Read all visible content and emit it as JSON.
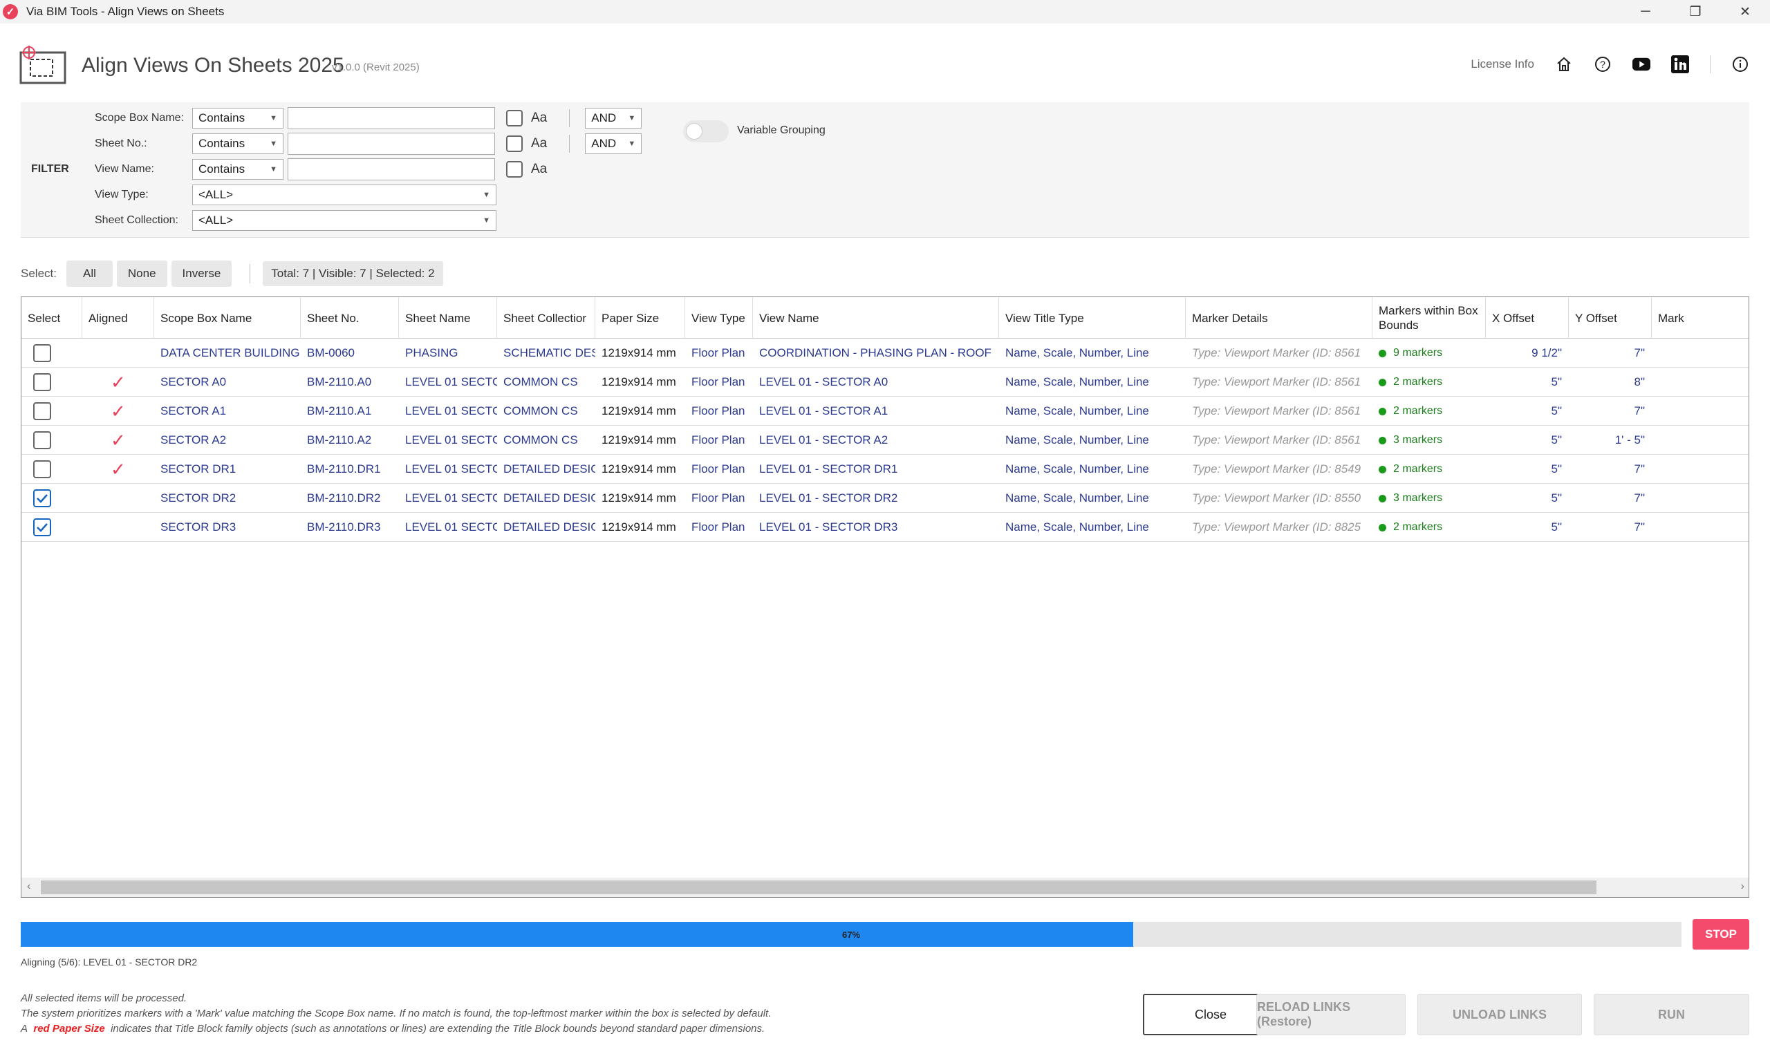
{
  "window": {
    "title": "Via BIM Tools - Align Views on Sheets"
  },
  "header": {
    "title": "Align Views On Sheets 2025",
    "version": "v1.0.0 (Revit 2025)",
    "license_label": "License Info"
  },
  "filter": {
    "label": "FILTER",
    "scope_box": {
      "label": "Scope Box Name:",
      "mode": "Contains",
      "value": "",
      "case_label": "Aa",
      "logic": "AND"
    },
    "sheet_no": {
      "label": "Sheet No.:",
      "mode": "Contains",
      "value": "",
      "case_label": "Aa",
      "logic": "AND"
    },
    "view_name": {
      "label": "View Name:",
      "mode": "Contains",
      "value": "",
      "case_label": "Aa"
    },
    "view_type": {
      "label": "View Type:",
      "value": "<ALL>"
    },
    "sheet_collection": {
      "label": "Sheet Collection:",
      "value": "<ALL>"
    },
    "variable_grouping": {
      "label": "Variable Grouping",
      "on": false
    }
  },
  "select_bar": {
    "label": "Select:",
    "all": "All",
    "none": "None",
    "inverse": "Inverse",
    "counts": "Total: 7 | Visible: 7 | Selected: 2"
  },
  "table": {
    "headers": {
      "select": "Select",
      "aligned": "Aligned",
      "scope": "Scope Box Name",
      "sheet_no": "Sheet No.",
      "sheet_name": "Sheet Name",
      "collection": "Sheet Collectior",
      "paper": "Paper Size",
      "view_type": "View Type",
      "view_name": "View Name",
      "title_type": "View Title Type",
      "marker": "Marker Details",
      "within": "Markers within Box Bounds",
      "xoff": "X Offset",
      "yoff": "Y Offset",
      "mark": "Mark"
    },
    "rows": [
      {
        "selected": false,
        "aligned": false,
        "scope": "DATA CENTER BUILDING",
        "sheet_no": "BM-0060",
        "sheet_name": "PHASING",
        "collection": "SCHEMATIC DES",
        "paper": "1219x914 mm",
        "view_type": "Floor Plan",
        "view_name": "COORDINATION - PHASING PLAN - ROOF",
        "title_type": "Name, Scale, Number, Line",
        "marker": "Type: Viewport Marker (ID: 8561",
        "within": "9 markers",
        "xoff": "9 1/2\"",
        "yoff": "7\"",
        "mark": ""
      },
      {
        "selected": false,
        "aligned": true,
        "scope": "SECTOR A0",
        "sheet_no": "BM-2110.A0",
        "sheet_name": "LEVEL 01 SECTC",
        "collection": "COMMON CS",
        "paper": "1219x914 mm",
        "view_type": "Floor Plan",
        "view_name": "LEVEL 01 - SECTOR A0",
        "title_type": "Name, Scale, Number, Line",
        "marker": "Type: Viewport Marker (ID: 8561",
        "within": "2 markers",
        "xoff": "5\"",
        "yoff": "8\"",
        "mark": ""
      },
      {
        "selected": false,
        "aligned": true,
        "scope": "SECTOR A1",
        "sheet_no": "BM-2110.A1",
        "sheet_name": "LEVEL 01 SECTC",
        "collection": "COMMON CS",
        "paper": "1219x914 mm",
        "view_type": "Floor Plan",
        "view_name": "LEVEL 01 - SECTOR A1",
        "title_type": "Name, Scale, Number, Line",
        "marker": "Type: Viewport Marker (ID: 8561",
        "within": "2 markers",
        "xoff": "5\"",
        "yoff": "7\"",
        "mark": ""
      },
      {
        "selected": false,
        "aligned": true,
        "scope": "SECTOR A2",
        "sheet_no": "BM-2110.A2",
        "sheet_name": "LEVEL 01 SECTC",
        "collection": "COMMON CS",
        "paper": "1219x914 mm",
        "view_type": "Floor Plan",
        "view_name": "LEVEL 01 - SECTOR A2",
        "title_type": "Name, Scale, Number, Line",
        "marker": "Type: Viewport Marker (ID: 8561",
        "within": "3 markers",
        "xoff": "5\"",
        "yoff": "1' - 5\"",
        "mark": ""
      },
      {
        "selected": false,
        "aligned": true,
        "scope": "SECTOR DR1",
        "sheet_no": "BM-2110.DR1",
        "sheet_name": "LEVEL 01 SECTC",
        "collection": "DETAILED DESIC",
        "paper": "1219x914 mm",
        "view_type": "Floor Plan",
        "view_name": "LEVEL 01 - SECTOR DR1",
        "title_type": "Name, Scale, Number, Line",
        "marker": "Type: Viewport Marker (ID: 8549",
        "within": "2 markers",
        "xoff": "5\"",
        "yoff": "7\"",
        "mark": ""
      },
      {
        "selected": true,
        "aligned": false,
        "scope": "SECTOR DR2",
        "sheet_no": "BM-2110.DR2",
        "sheet_name": "LEVEL 01 SECTC",
        "collection": "DETAILED DESIC",
        "paper": "1219x914 mm",
        "view_type": "Floor Plan",
        "view_name": "LEVEL 01 - SECTOR DR2",
        "title_type": "Name, Scale, Number, Line",
        "marker": "Type: Viewport Marker (ID: 8550",
        "within": "3 markers",
        "xoff": "5\"",
        "yoff": "7\"",
        "mark": ""
      },
      {
        "selected": true,
        "aligned": false,
        "scope": "SECTOR DR3",
        "sheet_no": "BM-2110.DR3",
        "sheet_name": "LEVEL 01 SECTC",
        "collection": "DETAILED DESIC",
        "paper": "1219x914 mm",
        "view_type": "Floor Plan",
        "view_name": "LEVEL 01 - SECTOR DR3",
        "title_type": "Name, Scale, Number, Line",
        "marker": "Type: Viewport Marker (ID: 8825",
        "within": "2 markers",
        "xoff": "5\"",
        "yoff": "7\"",
        "mark": ""
      }
    ]
  },
  "progress": {
    "value": 0.67,
    "label": "67%",
    "status": "Aligning (5/6): LEVEL 01 - SECTOR DR2",
    "stop": "STOP"
  },
  "notes": {
    "line1": "All selected items will be processed.",
    "line2": "The system prioritizes markers with a 'Mark' value matching the Scope Box name. If no match is found, the top-leftmost marker within the box is selected by default.",
    "line3_prefix": "A",
    "line3_red": "red Paper Size",
    "line3_suffix": "indicates that Title Block family objects (such as annotations or lines) are extending the Title Block bounds beyond standard paper dimensions."
  },
  "footer": {
    "close": "Close",
    "reload": "RELOAD LINKS (Restore)",
    "unload": "UNLOAD LINKS",
    "run": "RUN"
  },
  "colors": {
    "accent": "#e8415c",
    "progress": "#1e88f0",
    "stop": "#f44a6b",
    "link_text": "#2b3990",
    "green": "#1a9a1a"
  }
}
